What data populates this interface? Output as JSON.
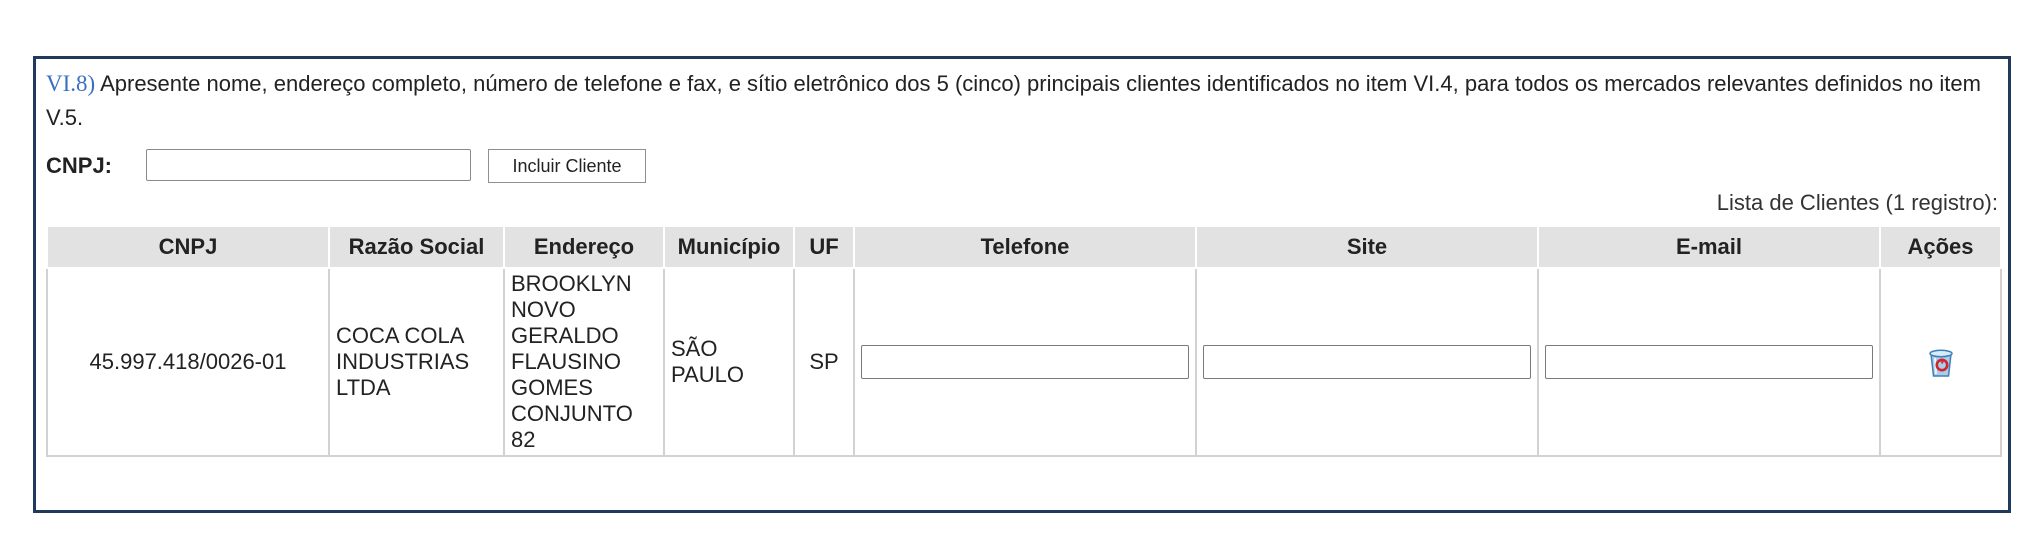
{
  "question": {
    "number": "VI.8)",
    "text": " Apresente nome, endereço completo, número de telefone e fax, e sítio eletrônico dos 5 (cinco) principais clientes identificados no item VI.4, para todos os mercados relevantes definidos no item V.5."
  },
  "cnpj_form": {
    "label": "CNPJ:",
    "input_value": "",
    "button_label": "Incluir Cliente"
  },
  "list": {
    "caption": "Lista de Clientes (1 registro):",
    "columns": [
      "CNPJ",
      "Razão Social",
      "Endereço",
      "Município",
      "UF",
      "Telefone",
      "Site",
      "E-mail",
      "Ações"
    ],
    "rows": [
      {
        "cnpj": "45.997.418/0026-01",
        "razao_social": "COCA COLA INDUSTRIAS LTDA",
        "endereco": "BROOKLYN NOVO GERALDO FLAUSINO GOMES CONJUNTO 82",
        "municipio": "SÃO PAULO",
        "uf": "SP",
        "telefone": "",
        "site": "",
        "email": "",
        "action_icon": "recycle-bin-icon"
      }
    ]
  },
  "colors": {
    "panel_border": "#203a5c",
    "question_number": "#3a6fc4",
    "header_bg": "#e2e2e2",
    "table_top_line": "#8a9a5b"
  }
}
